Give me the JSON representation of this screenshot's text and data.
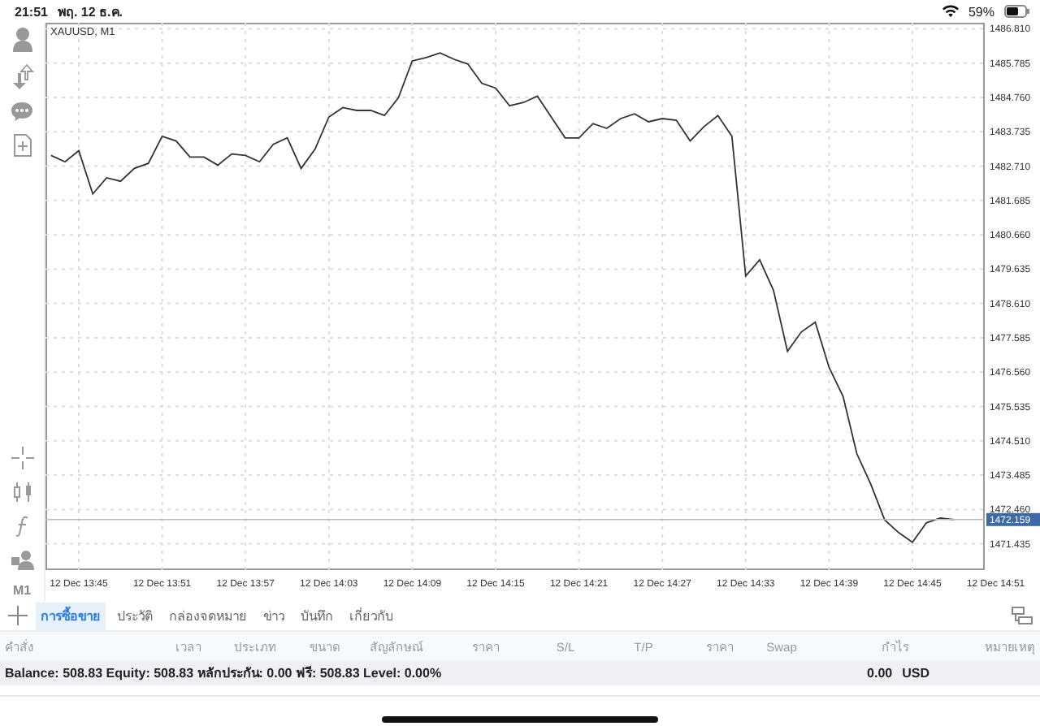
{
  "status_bar": {
    "time": "21:51",
    "date": "พฤ. 12 ธ.ค.",
    "battery": "59%"
  },
  "toolbar": {
    "timeframe": "M1"
  },
  "chart": {
    "symbol": "XAUUSD, M1",
    "current_price": "1472.159",
    "chart_data": {
      "type": "line",
      "categories": [
        null,
        null,
        "12 Dec 13:45",
        null,
        null,
        null,
        null,
        null,
        "12 Dec 13:51",
        null,
        null,
        null,
        null,
        null,
        "12 Dec 13:57",
        null,
        null,
        null,
        null,
        null,
        "12 Dec 14:03",
        null,
        null,
        null,
        null,
        null,
        "12 Dec 14:09",
        null,
        null,
        null,
        null,
        null,
        "12 Dec 14:15",
        null,
        null,
        null,
        null,
        null,
        "12 Dec 14:21",
        null,
        null,
        null,
        null,
        null,
        "12 Dec 14:27",
        null,
        null,
        null,
        null,
        null,
        "12 Dec 14:33",
        null,
        null,
        null,
        null,
        null,
        "12 Dec 14:39",
        null,
        null,
        null,
        null,
        null,
        "12 Dec 14:45",
        null,
        null,
        null,
        null,
        null,
        "12 Dec 14:51"
      ],
      "series": [
        {
          "color": "#333333",
          "values": [
            1483.03,
            1482.84,
            1483.17,
            1481.88,
            1482.36,
            1482.26,
            1482.64,
            1482.79,
            1483.6,
            1483.46,
            1482.98,
            1482.98,
            1482.74,
            1483.07,
            1483.03,
            1482.84,
            1483.36,
            1483.55,
            1482.64,
            1483.22,
            1484.18,
            1484.46,
            1484.37,
            1484.37,
            1484.22,
            1484.75,
            1485.85,
            1485.95,
            1486.09,
            1485.9,
            1485.76,
            1485.18,
            1485.04,
            1484.51,
            1484.61,
            1484.8,
            1484.18,
            1483.55,
            1483.55,
            1483.98,
            1483.84,
            1484.13,
            1484.27,
            1484.03,
            1484.13,
            1484.08,
            1483.46,
            1483.89,
            1484.22,
            1483.6,
            1479.43,
            1479.91,
            1479.0,
            1477.18,
            1477.76,
            1478.05,
            1476.7,
            1475.84,
            1474.12,
            1473.21,
            1472.15,
            1471.77,
            1471.48,
            1472.06,
            1472.2,
            1472.16,
            null,
            null,
            null
          ]
        }
      ],
      "ylim": [
        1470.65,
        1486.99
      ],
      "grid": true,
      "ref_lines": [
        {
          "axis": "y",
          "value": 1472.159,
          "color": "#bbbbbb"
        }
      ],
      "yticks": [
        {
          "value": 1486.81,
          "label": "1486.810"
        },
        {
          "value": 1485.785,
          "label": "1485.785"
        },
        {
          "value": 1484.76,
          "label": "1484.760"
        },
        {
          "value": 1483.735,
          "label": "1483.735"
        },
        {
          "value": 1482.71,
          "label": "1482.710"
        },
        {
          "value": 1481.685,
          "label": "1481.685"
        },
        {
          "value": 1480.66,
          "label": "1480.660"
        },
        {
          "value": 1479.635,
          "label": "1479.635"
        },
        {
          "value": 1478.61,
          "label": "1478.610"
        },
        {
          "value": 1477.585,
          "label": "1477.585"
        },
        {
          "value": 1476.56,
          "label": "1476.560"
        },
        {
          "value": 1475.535,
          "label": "1475.535"
        },
        {
          "value": 1474.51,
          "label": "1474.510"
        },
        {
          "value": 1473.485,
          "label": "1473.485"
        },
        {
          "value": 1472.46,
          "label": "1472.460"
        },
        {
          "value": 1471.435,
          "label": "1471.435"
        }
      ]
    }
  },
  "tabs": [
    {
      "label": "การซื้อขาย",
      "selected": true
    },
    {
      "label": "ประวัติ",
      "selected": false
    },
    {
      "label": "กล่องจดหมาย",
      "selected": false
    },
    {
      "label": "ข่าว",
      "selected": false
    },
    {
      "label": "บันทึก",
      "selected": false
    },
    {
      "label": "เกี่ยวกับ",
      "selected": false
    }
  ],
  "table": {
    "columns": [
      "คำสั่ง",
      "เวลา",
      "ประเภท",
      "ขนาด",
      "สัญลักษณ์",
      "ราคา",
      "S/L",
      "T/P",
      "ราคา",
      "Swap",
      "กำไร",
      "หมายเหตุ"
    ]
  },
  "summary": {
    "text": "Balance: 508.83 Equity: 508.83 หลักประกัน: 0.00 ฟรี: 508.83 Level: 0.00%",
    "profit": "0.00",
    "currency": "USD"
  }
}
